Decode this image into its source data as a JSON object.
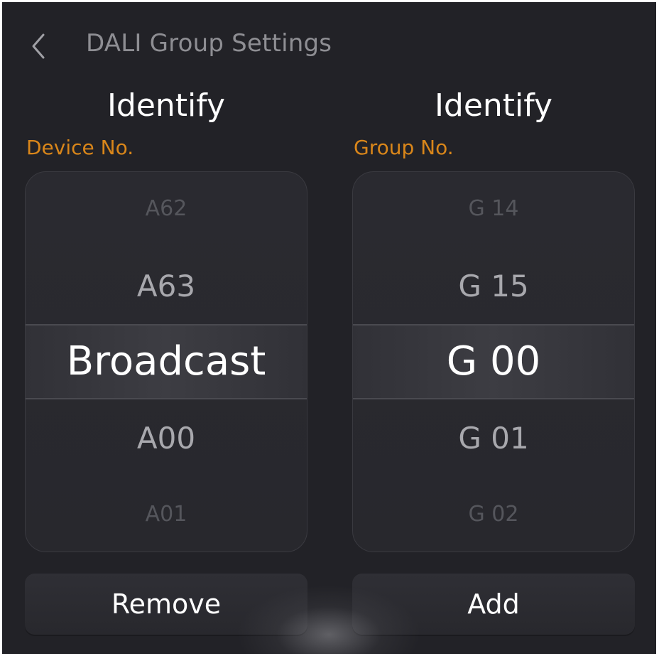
{
  "header": {
    "back_icon": "chevron-left-icon",
    "title": "DALI Group Settings"
  },
  "device_column": {
    "identify_label": "Identify",
    "caption": "Device No.",
    "picker": {
      "items": [
        "A62",
        "A63",
        "Broadcast",
        "A00",
        "A01"
      ],
      "selected": "Broadcast"
    },
    "action_label": "Remove"
  },
  "group_column": {
    "identify_label": "Identify",
    "caption": "Group No.",
    "picker": {
      "items": [
        "G 14",
        "G 15",
        "G 00",
        "G 01",
        "G 02"
      ],
      "selected": "G 00"
    },
    "action_label": "Add"
  },
  "colors": {
    "background": "#222227",
    "caption_accent": "#d9861a",
    "text_primary": "#ffffff",
    "text_dim": "#55565c"
  }
}
